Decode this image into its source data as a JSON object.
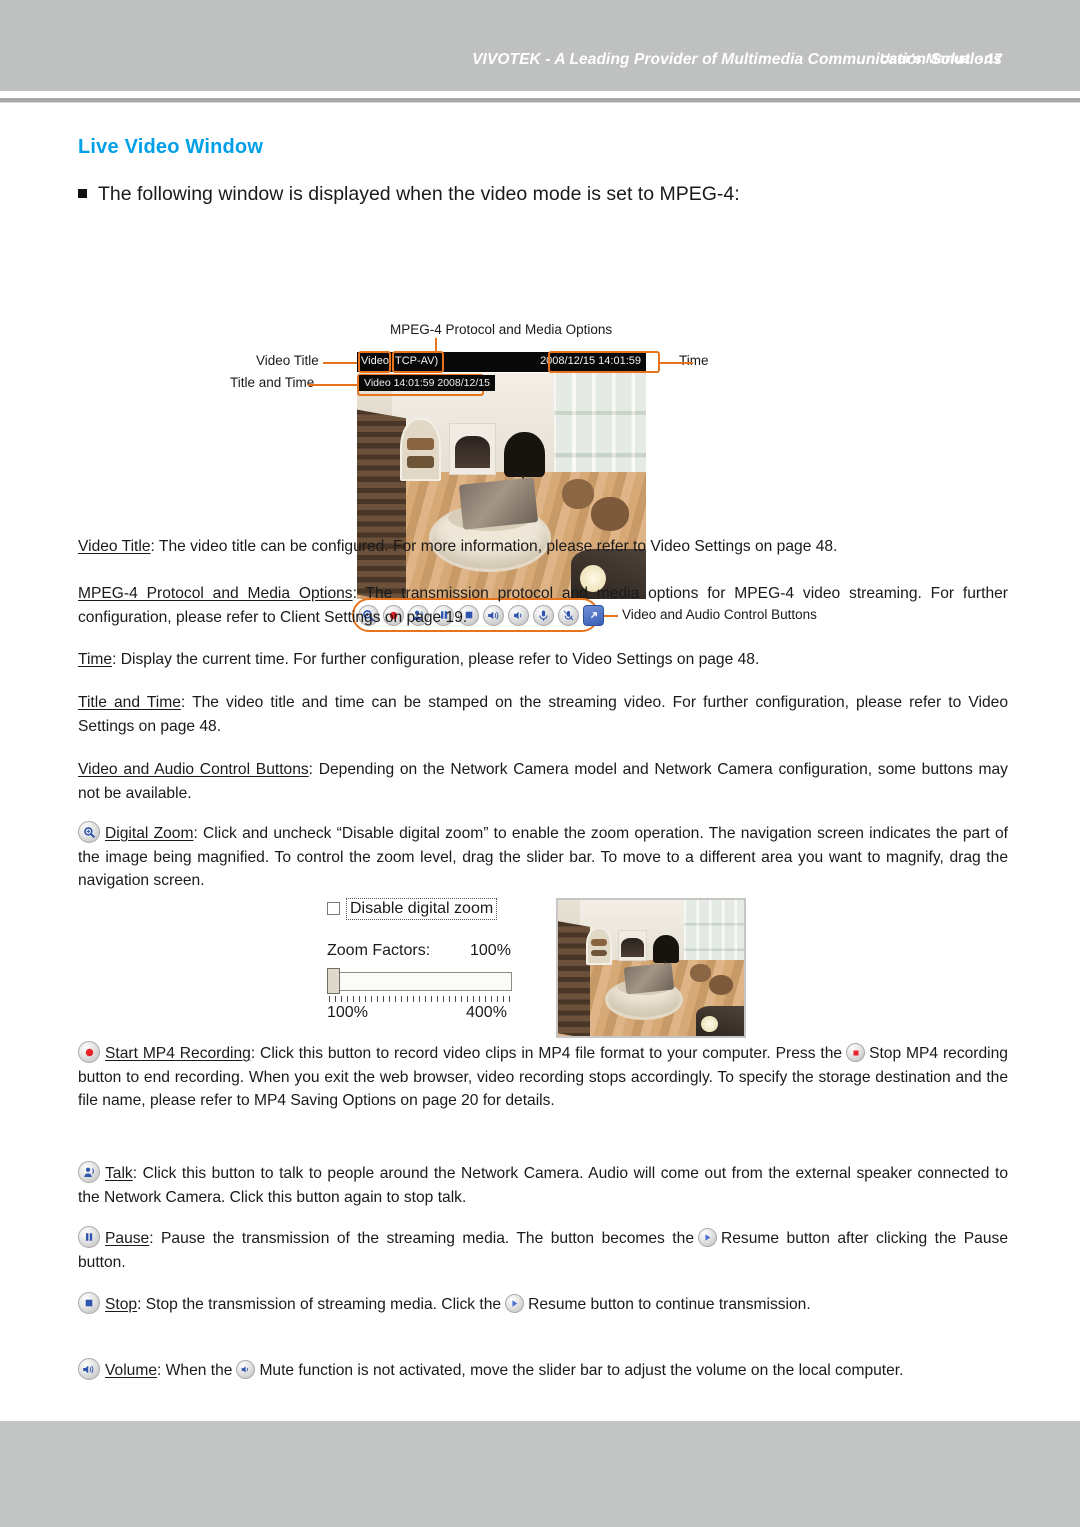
{
  "header": {
    "title": "VIVOTEK - A Leading Provider of Multimedia Communication Solutions"
  },
  "footer": {
    "text": "User's Manual - 17"
  },
  "colors": {
    "heading": "#00a0e9",
    "header_band": "#bfc1c1",
    "footer_band": "#c3c5c5",
    "callout_orange": "#e8731a",
    "icon_blue": "#3a5fb5",
    "record_red": "#e8242a"
  },
  "section": {
    "title": "Live Video Window",
    "bullet": "The following window is displayed when the video mode is set to MPEG-4:"
  },
  "figure": {
    "labels": {
      "protocol": "MPEG-4 Protocol and Media Options",
      "video_title": "Video Title",
      "title_and_time": "Title and Time",
      "time": "Time",
      "control_buttons": "Video and Audio Control Buttons"
    },
    "video_window": {
      "title_text": "Video",
      "protocol_text": "TCP-AV)",
      "time_text": "2008/12/15 14:01:59",
      "stamp_text": "Video 14:01:59  2008/12/15"
    },
    "control_buttons": [
      {
        "name": "digital-zoom-button",
        "icon": "magnifier-icon"
      },
      {
        "name": "start-mp4-recording-button",
        "icon": "record-icon"
      },
      {
        "name": "talk-button",
        "icon": "talk-person-icon"
      },
      {
        "name": "pause-button",
        "icon": "pause-icon"
      },
      {
        "name": "stop-button",
        "icon": "stop-icon"
      },
      {
        "name": "volume-button",
        "icon": "speaker-icon"
      },
      {
        "name": "mute-button",
        "icon": "speaker-mute-icon"
      },
      {
        "name": "mic-volume-button",
        "icon": "microphone-icon"
      },
      {
        "name": "mic-mute-button",
        "icon": "microphone-mute-icon"
      },
      {
        "name": "fullscreen-button",
        "icon": "expand-arrow-icon"
      }
    ]
  },
  "paragraphs": {
    "video_title": {
      "term": "Video Title",
      "body": ": The video title can be configured. For more information, please refer to Video Settings on page 48."
    },
    "protocol": {
      "term": "MPEG-4 Protocol and Media Options",
      "body": ": The transmission protocol and media options for MPEG-4 video streaming. For further configuration, please refer to Client Settings on page 19."
    },
    "time": {
      "term": "Time",
      "body": ": Display the current time. For further configuration, please refer to Video Settings on page 48."
    },
    "title_and_time": {
      "term": "Title and Time",
      "body": ": The video title and time can be stamped on the streaming video. For further configuration, please refer to Video Settings on page 48."
    },
    "control_buttons": {
      "term": "Video and Audio Control Buttons",
      "body": ": Depending on the Network Camera model and Network Camera configuration, some buttons may not be available."
    },
    "digital_zoom": {
      "term": "Digital Zoom",
      "body": ": Click and uncheck “Disable digital zoom” to enable the zoom operation. The navigation screen indicates the part of the image being magnified. To control the zoom level, drag the slider bar. To move to a different area you want to magnify, drag the navigation screen."
    },
    "mp4_recording": {
      "term": "Start MP4 Recording",
      "body_1": ": Click this button to record video clips in MP4 file format to your computer. Press the",
      "body_2": "Stop MP4 recording button to end recording. When you exit the web browser, video recording stops accordingly. To specify the storage destination and the file name, please refer to MP4 Saving Options on page 20 for details."
    },
    "talk": {
      "term": "Talk",
      "body": ": Click this button to talk to people around the Network Camera. Audio will come out from the external speaker connected to the Network Camera. Click this button again to stop talk."
    },
    "pause": {
      "term": "Pause",
      "body_1": ": Pause the transmission of the streaming media. The button becomes the",
      "body_2": "Resume button after clicking the Pause button."
    },
    "stop": {
      "term": "Stop",
      "body_1": ": Stop the transmission of streaming media. Click the",
      "body_2": "Resume button to continue transmission."
    },
    "volume": {
      "term": "Volume",
      "body_1": ": When the",
      "body_2": "Mute function is not activated, move the slider bar to adjust the volume on the local computer."
    }
  },
  "zoom_dialog": {
    "checkbox_label": "Disable digital zoom",
    "checkbox_checked": false,
    "zoom_factors_label": "Zoom Factors:",
    "zoom_factors_value": "100%",
    "slider_min": "100%",
    "slider_max": "400%",
    "slider_position_percent": 0
  }
}
